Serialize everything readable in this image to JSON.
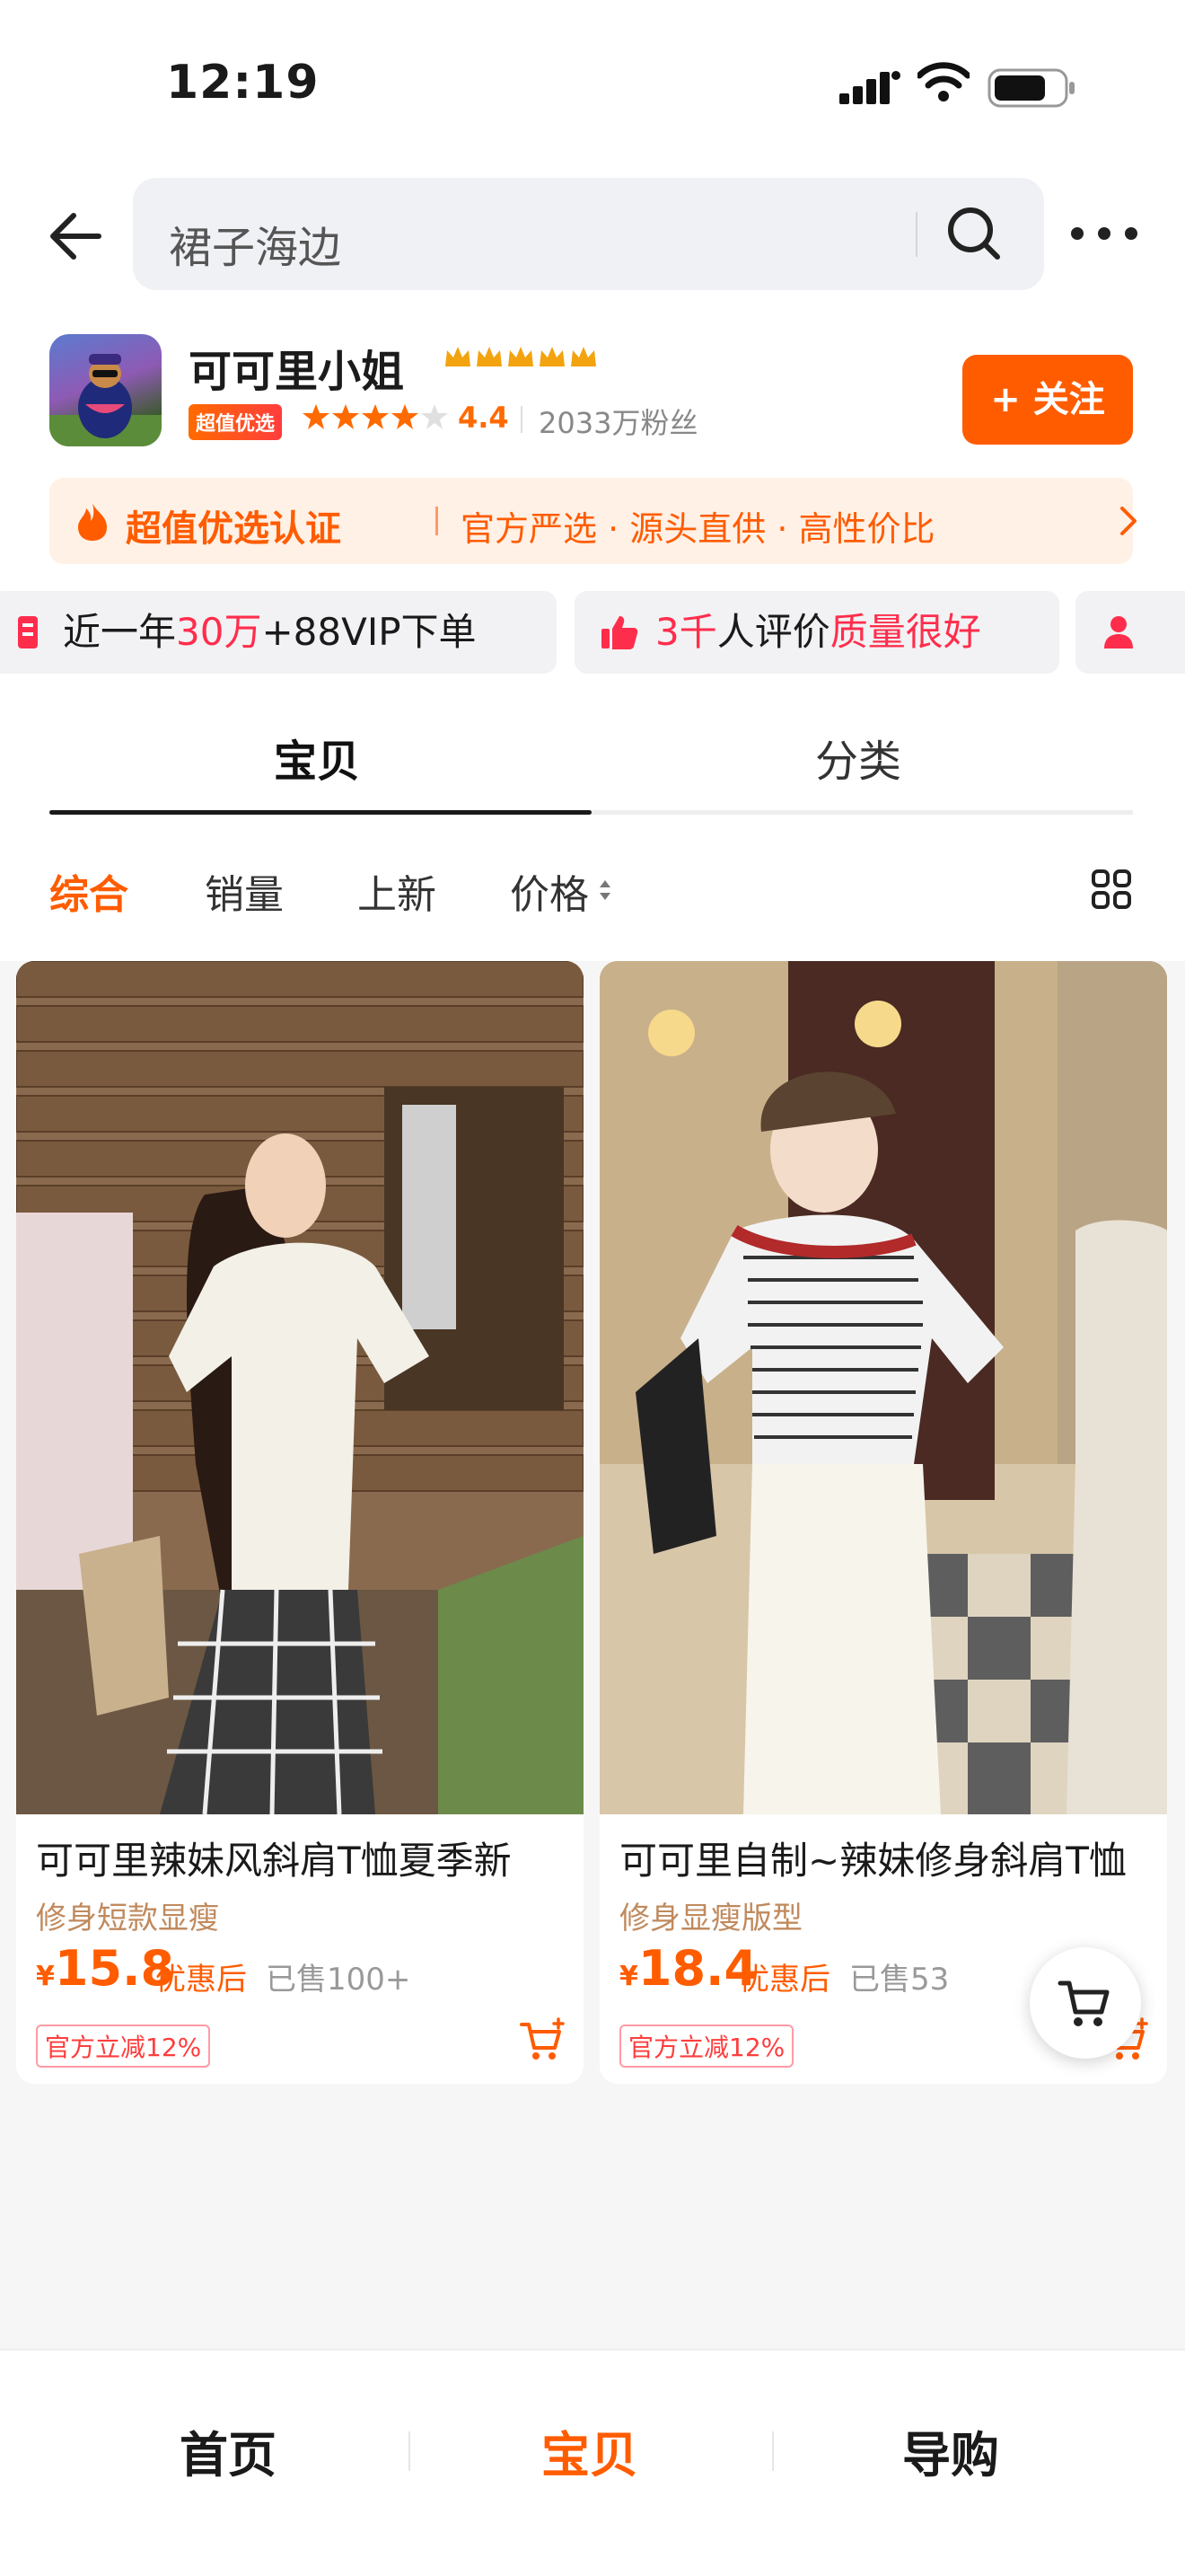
{
  "status_bar": {
    "time": "12:19"
  },
  "header": {
    "search_query": "裙子海边"
  },
  "shop": {
    "name": "可可里小姐",
    "badge": "超值优选",
    "rating": "4.4",
    "fans": "2033万粉丝",
    "follow_label": "+ 关注",
    "certification": {
      "title": "超值优选认证",
      "desc": "官方严选 · 源头直供 · 高性价比"
    },
    "tags": [
      {
        "prefix": "近一年",
        "highlight": "30万",
        "suffix": "+88VIP下单"
      },
      {
        "prefix": "3千",
        "middle": "人评价",
        "highlight": "质量很好"
      }
    ]
  },
  "tabs": [
    {
      "label": "宝贝",
      "active": true
    },
    {
      "label": "分类",
      "active": false
    }
  ],
  "sort": [
    {
      "label": "综合",
      "active": true
    },
    {
      "label": "销量"
    },
    {
      "label": "上新"
    },
    {
      "label": "价格"
    }
  ],
  "products": [
    {
      "title": "可可里辣妹风斜肩T恤夏季新",
      "subtitle": "修身短款显瘦",
      "currency": "¥",
      "price": "15.8",
      "after_label": "优惠后",
      "sold": "已售100+",
      "promo": "官方立减12%"
    },
    {
      "title": "可可里自制~辣妹修身斜肩T恤",
      "subtitle": "修身显瘦版型",
      "currency": "¥",
      "price": "18.4",
      "after_label": "优惠后",
      "sold": "已售53",
      "promo": "官方立减12%"
    }
  ],
  "bottom_nav": [
    {
      "label": "首页"
    },
    {
      "label": "宝贝",
      "active": true
    },
    {
      "label": "导购"
    }
  ],
  "colors": {
    "accent": "#ff5c00",
    "highlight_red": "#ff2d4c"
  }
}
